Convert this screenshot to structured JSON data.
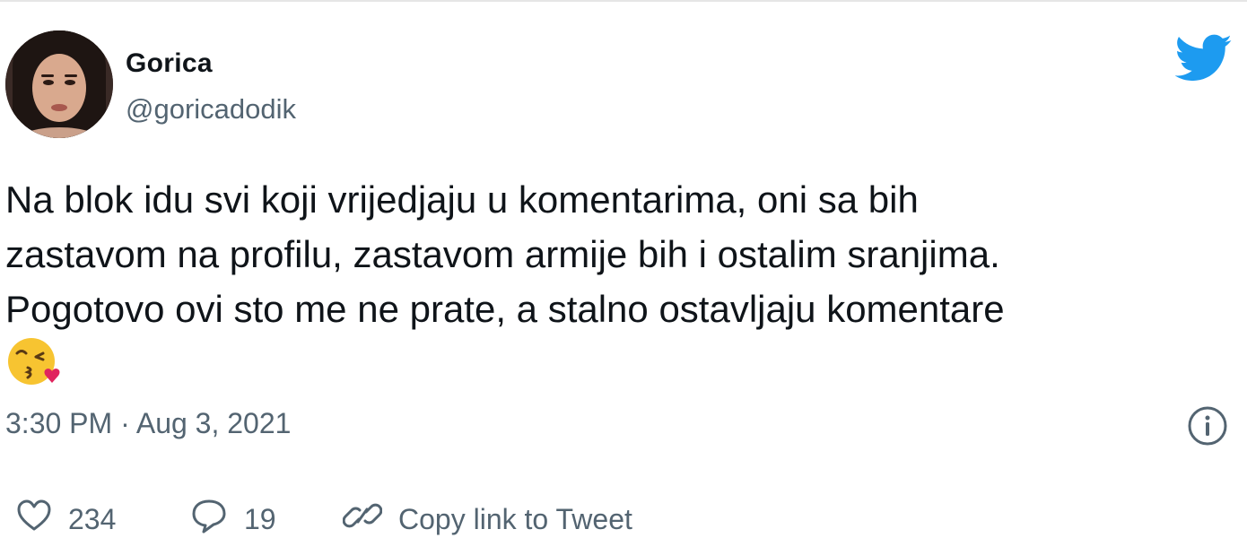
{
  "author": {
    "display_name": "Gorica",
    "handle": "@goricadodik"
  },
  "tweet": {
    "lines": [
      "Na blok idu svi koji vrijedjaju u komentarima, oni sa bih",
      "zastavom na profilu, zastavom armije bih i ostalim sranjima.",
      "Pogotovo ovi sto me ne prate, a stalno ostavljaju komentare"
    ],
    "emoji": "face-blowing-a-kiss",
    "timestamp": "3:30 PM · Aug 3, 2021"
  },
  "actions": {
    "likes": "234",
    "replies": "19",
    "copy_link_label": "Copy link to Tweet"
  },
  "icons": {
    "brand": "twitter-bird-icon",
    "info": "info-icon",
    "like": "heart-icon",
    "reply": "speech-bubble-icon",
    "link": "link-icon"
  },
  "colors": {
    "brand_blue": "#1d9bf0",
    "text_primary": "#0f1419",
    "text_secondary": "#536471"
  }
}
